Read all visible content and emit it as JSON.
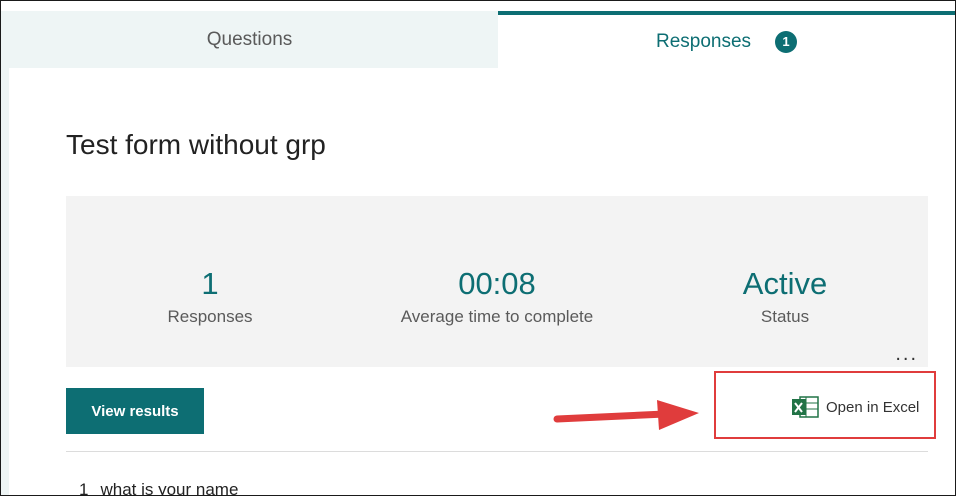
{
  "tabs": {
    "questions_label": "Questions",
    "responses_label": "Responses",
    "responses_badge": "1"
  },
  "form": {
    "title": "Test form without grp"
  },
  "summary": {
    "responses_value": "1",
    "responses_label": "Responses",
    "avg_time_value": "00:08",
    "avg_time_label": "Average time to complete",
    "status_value": "Active",
    "status_label": "Status",
    "more_label": "..."
  },
  "actions": {
    "view_results_label": "View results",
    "open_excel_label": "Open in Excel"
  },
  "questions": [
    {
      "number": "1",
      "text": "what is your name"
    }
  ],
  "colors": {
    "accent": "#0d6e73",
    "highlight_box": "#e03c3c",
    "arrow": "#e03c3c",
    "excel_green": "#217346"
  },
  "icons": [
    "excel-icon",
    "more-options-icon",
    "arrow-annotation"
  ]
}
